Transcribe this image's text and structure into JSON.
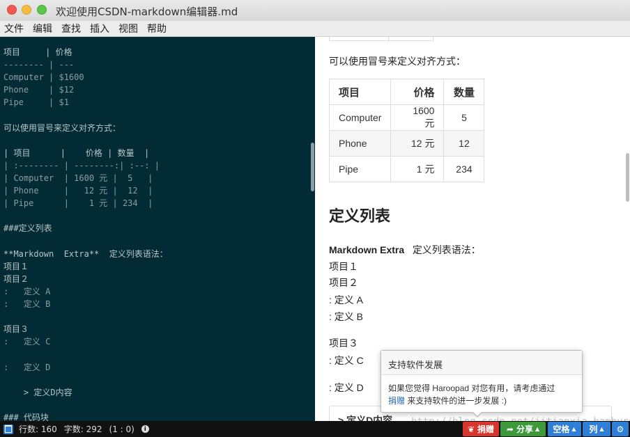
{
  "window": {
    "title": "欢迎使用CSDN-markdown编辑器.md"
  },
  "menu": [
    "文件",
    "编辑",
    "查找",
    "插入",
    "视图",
    "帮助"
  ],
  "editor_lines": [
    {
      "text": "项目     | 价格",
      "bright": true
    },
    {
      "text": "-------- | ---",
      "bright": false
    },
    {
      "text": "Computer | $1600",
      "bright": false
    },
    {
      "text": "Phone    | $12",
      "bright": false
    },
    {
      "text": "Pipe     | $1",
      "bright": false
    },
    {
      "text": "",
      "bright": false
    },
    {
      "text": "可以使用冒号来定义对齐方式：",
      "bright": true
    },
    {
      "text": "",
      "bright": false
    },
    {
      "text": "| 项目      |    价格 | 数量  |",
      "bright": true
    },
    {
      "text": "| :-------- | --------:| :--: |",
      "bright": false
    },
    {
      "text": "| Computer  | 1600 元 |  5   |",
      "bright": false
    },
    {
      "text": "| Phone     |   12 元 |  12  |",
      "bright": false
    },
    {
      "text": "| Pipe      |    1 元 | 234  |",
      "bright": false
    },
    {
      "text": "",
      "bright": false
    },
    {
      "text": "###定义列表",
      "bright": true
    },
    {
      "text": "",
      "bright": false
    },
    {
      "text": "**Markdown  Extra**  定义列表语法：",
      "bright": true
    },
    {
      "text": "项目１",
      "bright": true
    },
    {
      "text": "项目２",
      "bright": true
    },
    {
      "text": ":   定义 A",
      "bright": false
    },
    {
      "text": ":   定义 B",
      "bright": false
    },
    {
      "text": "",
      "bright": false
    },
    {
      "text": "项目３",
      "bright": true
    },
    {
      "text": ":   定义 C",
      "bright": false
    },
    {
      "text": "",
      "bright": false
    },
    {
      "text": ":   定义 D",
      "bright": false
    },
    {
      "text": "",
      "bright": false
    },
    {
      "text": "    > 定义D内容",
      "bright": true
    },
    {
      "text": "",
      "bright": false
    },
    {
      "text": "### 代码块",
      "bright": true
    }
  ],
  "preview": {
    "align_text": "可以使用冒号来定义对齐方式：",
    "table": {
      "headers": [
        "项目",
        "价格",
        "数量"
      ],
      "rows": [
        [
          "Computer",
          "1600 元",
          "5"
        ],
        [
          "Phone",
          "12 元",
          "12"
        ],
        [
          "Pipe",
          "1 元",
          "234"
        ]
      ]
    },
    "heading": "定义列表",
    "extra_bold": "Markdown  Extra",
    "extra_text": "定义列表语法：",
    "item1": "项目１",
    "item2": "项目２",
    "defA": ": 定义 A",
    "defB": ": 定义 B",
    "item3": "项目３",
    "defC": ": 定义 C",
    "defD": ": 定义 D",
    "box_text": "> 定义D内容"
  },
  "popup": {
    "title": "支持软件发展",
    "body_pre": "如果您觉得 Haroopad 对您有用，请考虑通过",
    "link": "捐赠",
    "body_post": " 来支持软件的进一步发展 :)"
  },
  "watermark": "http://blog.csdn.net/jitianxia_hamburg",
  "status": {
    "lines": "行数: 160",
    "chars": "字数: 292",
    "pos": "(1 : 0)",
    "donate": "捐赠",
    "share": "分享",
    "space": "空格",
    "col": "列"
  }
}
